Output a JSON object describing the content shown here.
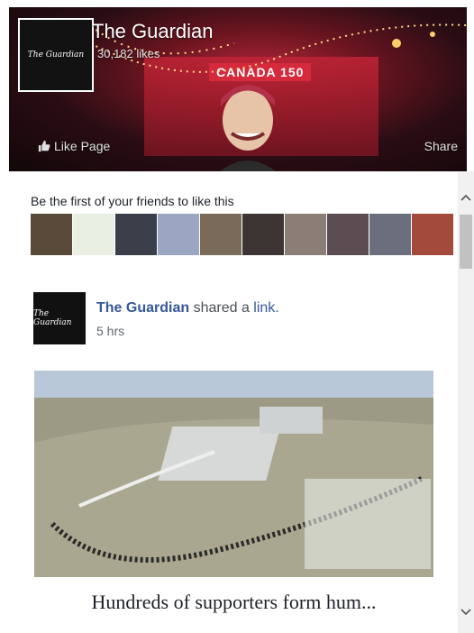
{
  "header": {
    "page_name": "The Guardian",
    "likes": "30,182 likes",
    "banner_text": "CANADA 150",
    "logo_text": "The Guardian",
    "like_page_label": "Like Page",
    "share_label": "Share"
  },
  "friends": {
    "text": "Be the first of your friends to like this",
    "avatar_colors": [
      "#5a4a3a",
      "#e9efe3",
      "#3b3f4a",
      "#9aa6c2",
      "#7a6a5a",
      "#3d3434",
      "#8b7e77",
      "#5b4d52",
      "#6b6f7d",
      "#a34a3c"
    ]
  },
  "post": {
    "author": "The Guardian",
    "action_text": " shared a ",
    "link_text": "link.",
    "time": "5 hrs",
    "avatar_text": "The Guardian",
    "caption": "Hundreds of supporters form hum..."
  },
  "colors": {
    "link_blue": "#365899",
    "text_dark": "#1d2129",
    "header_red": "#b3263a"
  },
  "icons": {
    "like_icon": "thumbs-up-icon",
    "scroll_up": "chevron-up-icon",
    "scroll_down": "chevron-down-icon"
  }
}
